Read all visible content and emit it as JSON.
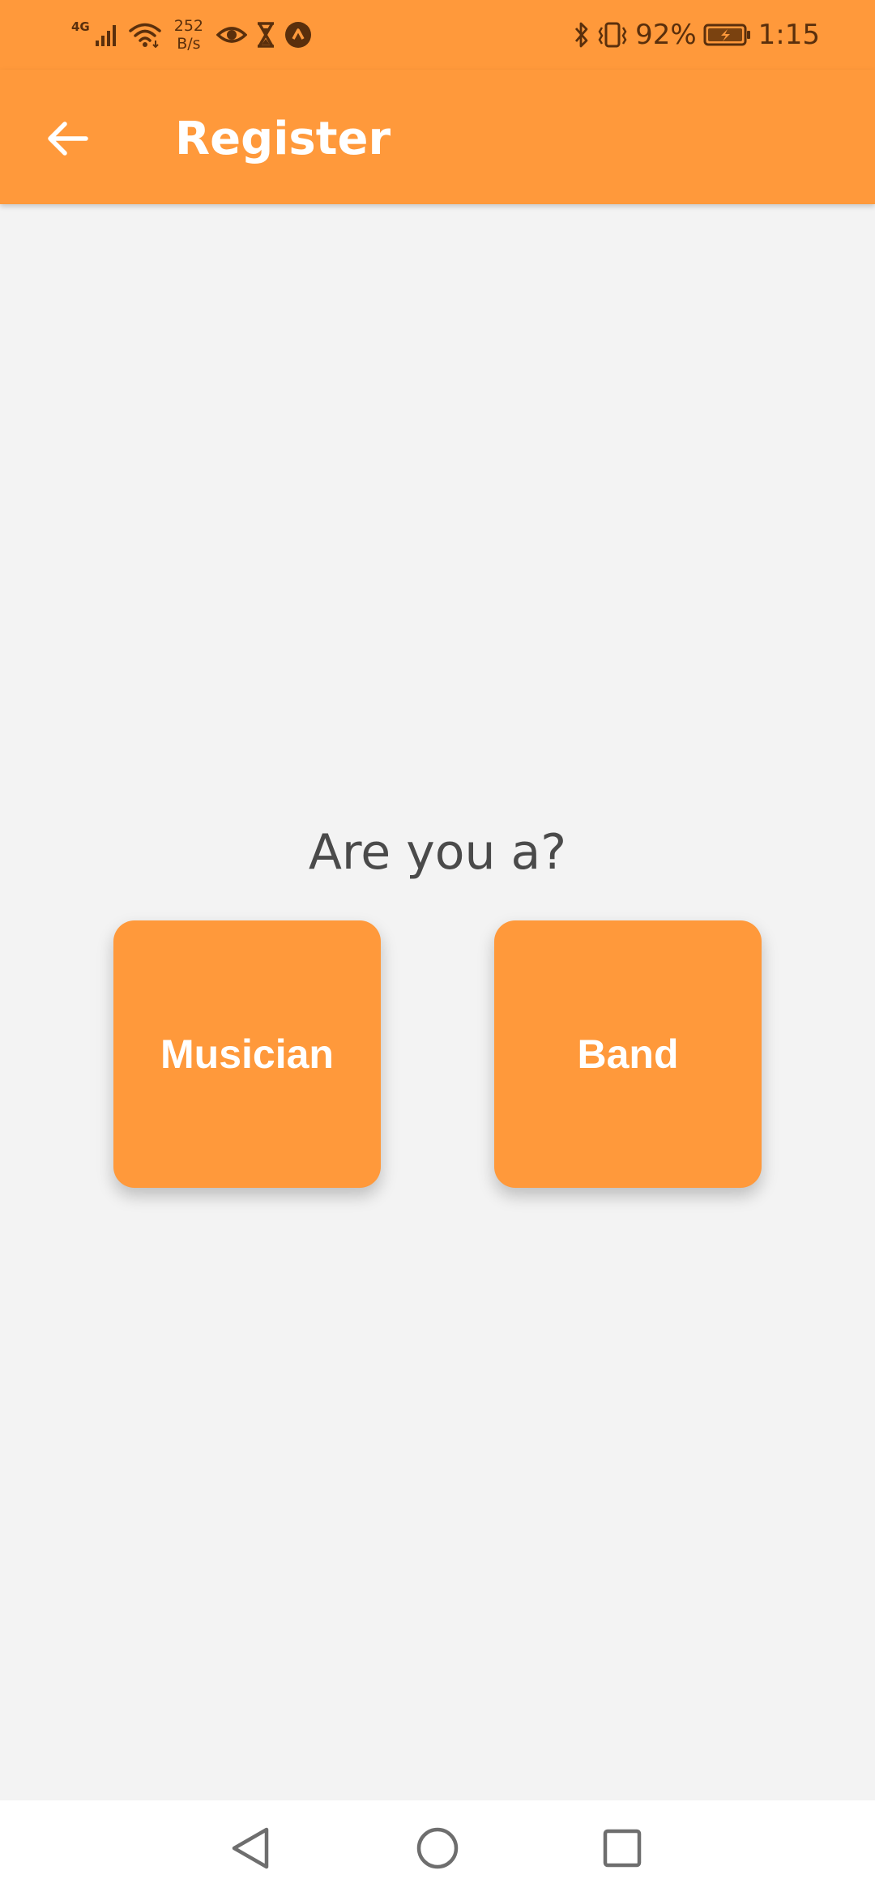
{
  "status_bar": {
    "network_type": "4G",
    "speed_value": "252",
    "speed_unit": "B/s",
    "battery_percent": "92%",
    "time": "1:15",
    "icons": [
      "signal-icon",
      "wifi-icon",
      "eye-icon",
      "hourglass-icon",
      "app-notification-icon",
      "bluetooth-icon",
      "vibrate-icon",
      "battery-charging-icon"
    ]
  },
  "app_bar": {
    "title": "Register",
    "back_icon": "arrow-left-icon"
  },
  "main": {
    "prompt": "Are you a?",
    "options": [
      {
        "label": "Musician"
      },
      {
        "label": "Band"
      }
    ]
  },
  "nav_bar": {
    "icons": [
      "nav-back-icon",
      "nav-home-icon",
      "nav-recents-icon"
    ]
  },
  "colors": {
    "accent": "#ff993b",
    "background": "#f3f3f3",
    "prompt_text": "#4a4a4a",
    "status_icons": "#5a2f0c"
  }
}
